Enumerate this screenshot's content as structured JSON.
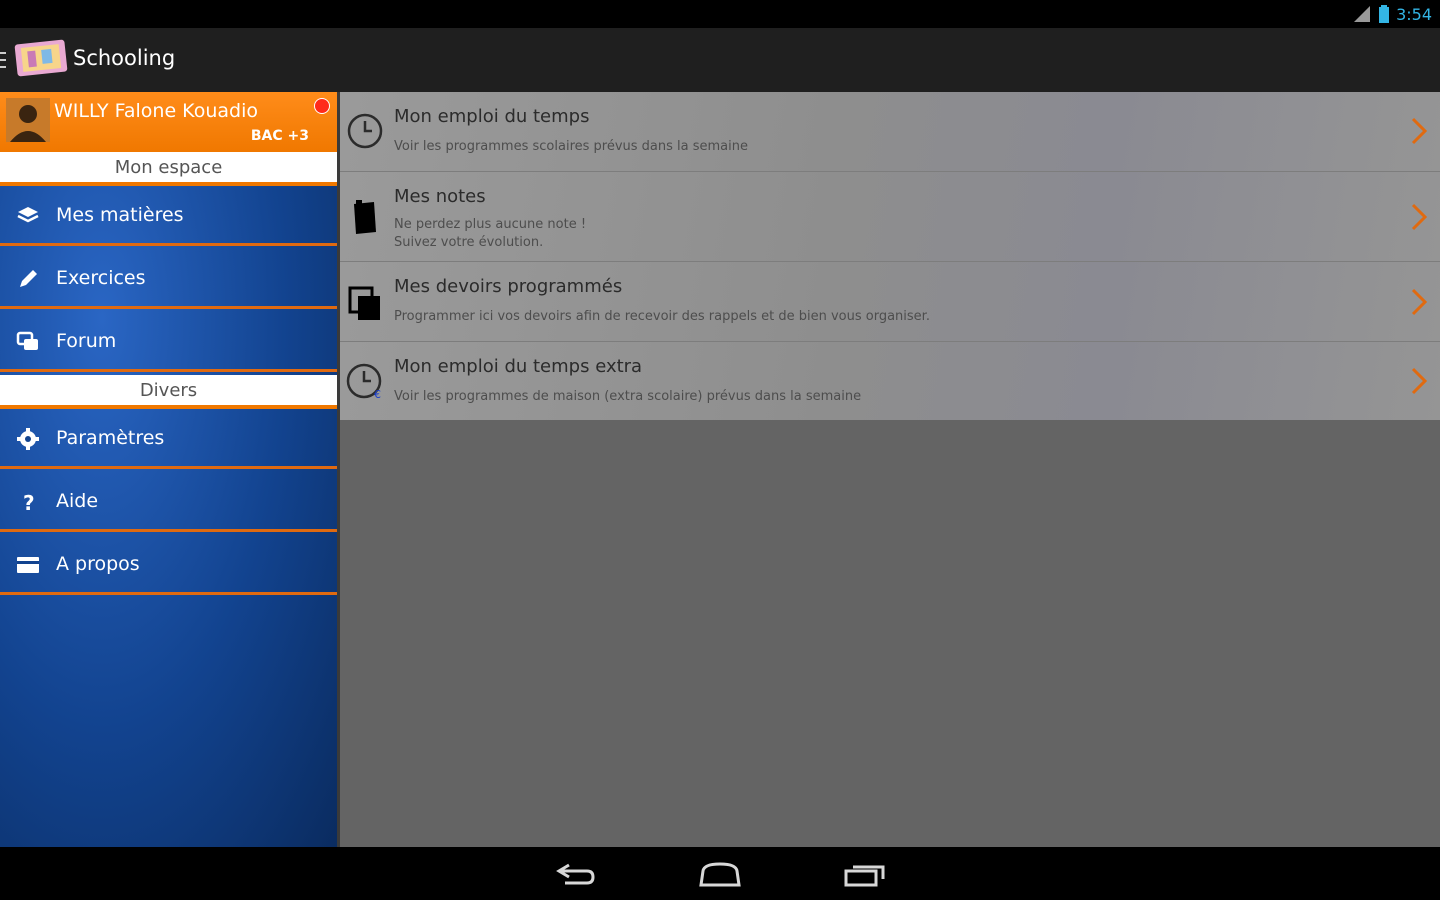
{
  "status_bar": {
    "time": "3:54"
  },
  "action_bar": {
    "title": "Schooling"
  },
  "user": {
    "name": "WILLY Falone Kouadio",
    "level": "BAC +3"
  },
  "sidebar": {
    "sections": [
      {
        "header": "Mon espace"
      },
      {
        "header": "Divers"
      }
    ],
    "items": [
      {
        "label": "Mes matières",
        "icon": "stack-icon"
      },
      {
        "label": "Exercices",
        "icon": "pencil-icon"
      },
      {
        "label": "Forum",
        "icon": "chat-icon"
      },
      {
        "label": "Paramètres",
        "icon": "gear-icon"
      },
      {
        "label": "Aide",
        "icon": "question-icon"
      },
      {
        "label": "A propos",
        "icon": "card-icon"
      }
    ]
  },
  "content": {
    "items": [
      {
        "title": "Mon emploi du temps",
        "subtitle": [
          "Voir les programmes scolaires prévus dans la semaine"
        ]
      },
      {
        "title": "Mes notes",
        "subtitle": [
          "Ne perdez plus aucune note !",
          "Suivez votre évolution."
        ]
      },
      {
        "title": "Mes devoirs programmés",
        "subtitle": [
          "Programmer ici vos devoirs afin de recevoir des rappels et de bien vous organiser."
        ]
      },
      {
        "title": "Mon emploi du temps extra",
        "subtitle": [
          "Voir les programmes de maison (extra scolaire) prévus dans la semaine"
        ]
      }
    ]
  },
  "colors": {
    "accent": "#f07800",
    "sidebar": "#12438f",
    "status": "#33b5e5"
  }
}
